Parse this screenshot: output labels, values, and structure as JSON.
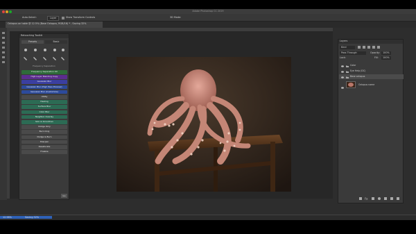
{
  "app": {
    "title": "Adobe Photoshop CC 2019"
  },
  "options_bar": {
    "auto_select_label": "Auto-Select:",
    "auto_select_value": "Layer",
    "transform_label": "Show Transform Controls",
    "mode_3d": "3D Mode:"
  },
  "document": {
    "tab_title": "Octopus on table @ 12.5% (Base Octopus, RGB/16) * - Saving 32%"
  },
  "retouch_panel": {
    "header": "Retouching Toolkit",
    "tabs": [
      "Presets",
      "Basic"
    ],
    "section_title": "Frequency Separation",
    "buttons": [
      {
        "label": "Frequency Separation Kit",
        "color": "#2e6b3a"
      },
      {
        "label": "High Layer Blending Copy",
        "color": "#5b2d8e"
      },
      {
        "label": "Gaussian Blur",
        "color": "#3b3fa0"
      },
      {
        "label": "Gaussian Blur (High Pass Preview)",
        "color": "#2c4a9c"
      },
      {
        "label": "Gaussian Blur (Customize)",
        "color": "#2c4a9c"
      },
      {
        "label": "Utility",
        "color": "#4a4a4a"
      },
      {
        "label": "Healing",
        "color": "#2c6b54"
      },
      {
        "label": "Surface Blur",
        "color": "#2c6b54"
      },
      {
        "label": "Color Blur",
        "color": "#2c6b54"
      },
      {
        "label": "Neighbor Overlay",
        "color": "#2c6b54"
      },
      {
        "label": "Skin & Smoothen",
        "color": "#2c6b54"
      },
      {
        "label": "Dodge Only",
        "color": "#4a4a4a"
      },
      {
        "label": "Burn Only",
        "color": "#4a4a4a"
      },
      {
        "label": "Dodge & Burn",
        "color": "#4a4a4a"
      },
      {
        "label": "Sharpen",
        "color": "#4a4a4a"
      },
      {
        "label": "Desaturate",
        "color": "#4a4a4a"
      },
      {
        "label": "Finalize",
        "color": "#4a4a4a"
      }
    ],
    "footer_btn": "Go"
  },
  "layers_panel": {
    "title": "Layers",
    "kind_label": "Kind",
    "blend_mode": "Pass Through",
    "opacity_label": "Opacity:",
    "opacity_value": "100%",
    "fill_label": "Fill:",
    "fill_value": "100%",
    "lock_label": "Lock:",
    "layers": [
      {
        "name": "Color",
        "type": "folder"
      },
      {
        "name": "Eye Help (DC)",
        "type": "folder"
      },
      {
        "name": "Base octopus",
        "type": "folder"
      },
      {
        "name": "Octopus name",
        "type": "image"
      }
    ]
  },
  "status": {
    "zoom": "12.98%",
    "info": "Saving 32%"
  }
}
